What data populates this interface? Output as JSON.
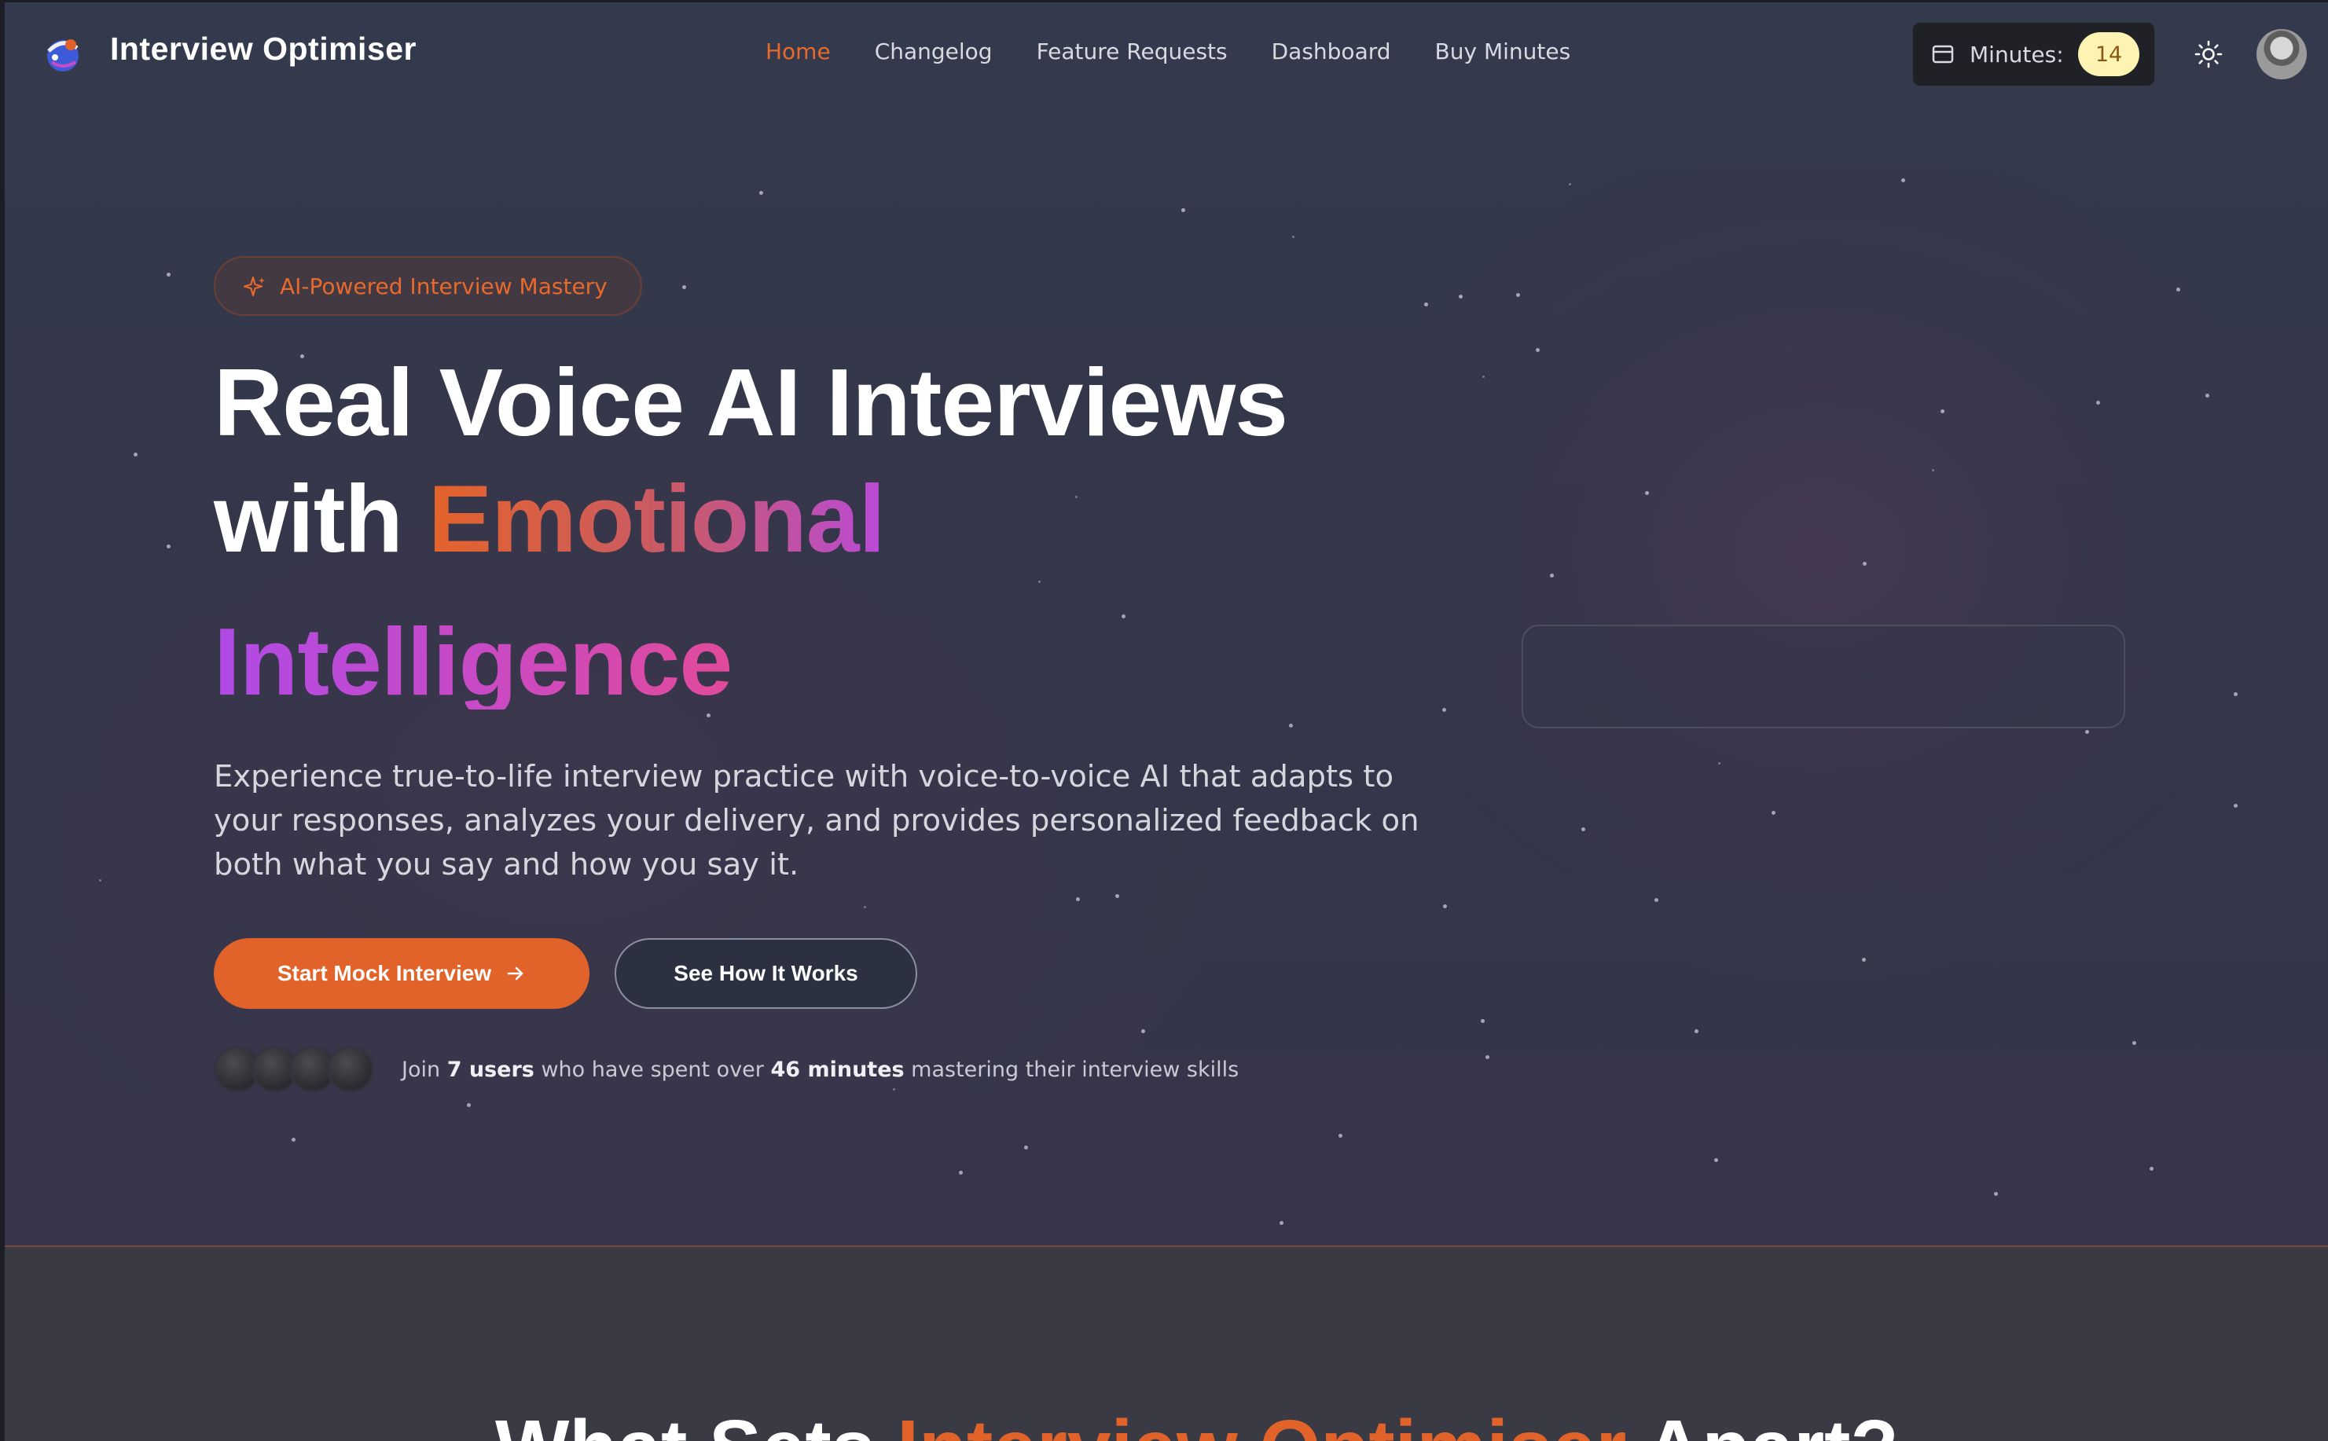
{
  "app": {
    "brand": "Interview Optimiser"
  },
  "nav": {
    "links": [
      "Home",
      "Changelog",
      "Feature Requests",
      "Dashboard",
      "Buy Minutes"
    ],
    "active": "Home",
    "minutes_label": "Minutes:",
    "minutes_count": "14"
  },
  "hero": {
    "badge": "AI-Powered Interview Mastery",
    "title_line1": "Real Voice AI Interviews",
    "title_with": "with ",
    "title_emotional": "Emotional",
    "title_intelligence": "Intelligence",
    "description": "Experience true-to-life interview practice with voice-to-voice AI that adapts to your responses, analyzes your delivery, and provides personalized feedback on both what you say and how you say it.",
    "primary_cta": "Start Mock Interview",
    "secondary_cta": "See How It Works",
    "social_proof": {
      "prefix": "Join ",
      "users": "7 users",
      "middle": " who have spent over ",
      "minutes": "46 minutes",
      "suffix": " mastering their interview skills"
    }
  },
  "section": {
    "title_start": "What Sets ",
    "title_accent": "Interview Optimiser",
    "title_end": " Apart?"
  },
  "colors": {
    "accent": "#e2632a",
    "background": "#343649",
    "minutes_badge": "#fdf3b3"
  },
  "icons": [
    "logo-icon",
    "card-icon",
    "sun-icon",
    "sparkle-icon",
    "arrow-right-icon"
  ]
}
